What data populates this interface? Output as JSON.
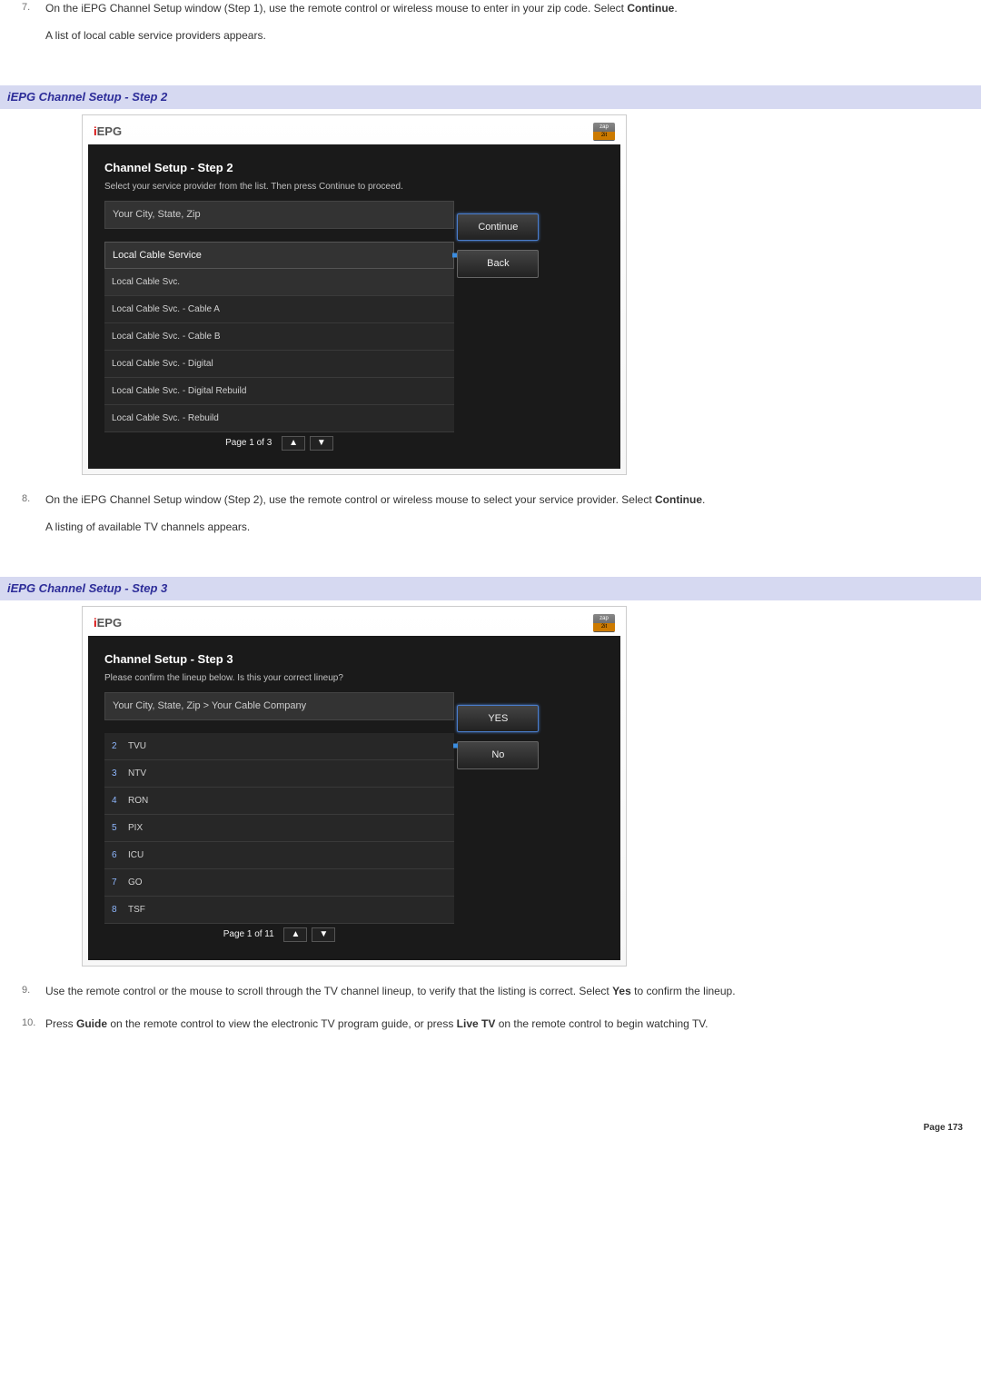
{
  "steps": {
    "s7": {
      "num": "7.",
      "text_a": "On the iEPG Channel Setup window (Step 1), use the remote control or wireless mouse to enter in your zip code. Select ",
      "text_b": "Continue",
      "text_c": ".",
      "note": "A list of local cable service providers appears."
    },
    "s8": {
      "num": "8.",
      "text_a": "On the iEPG Channel Setup window (Step 2), use the remote control or wireless mouse to select your service provider. Select ",
      "text_b": "Continue",
      "text_c": ".",
      "note": "A listing of available TV channels appears."
    },
    "s9": {
      "num": "9.",
      "text_a": "Use the remote control or the mouse to scroll through the TV channel lineup, to verify that the listing is correct. Select ",
      "text_b": "Yes",
      "text_c": " to confirm the lineup."
    },
    "s10": {
      "num": "10.",
      "text_a": "Press ",
      "text_b": "Guide",
      "text_c": " on the remote control to view the electronic TV program guide, or press ",
      "text_d": "Live TV",
      "text_e": " on the remote control to begin watching TV."
    }
  },
  "section2": {
    "title": "iEPG Channel Setup - Step 2"
  },
  "section3": {
    "title": "iEPG Channel Setup - Step 3"
  },
  "window2": {
    "logo_i": "i",
    "logo_rest": "EPG",
    "title": "Channel Setup - Step 2",
    "subtitle": "Select your service provider from the list. Then press Continue to proceed.",
    "breadcrumb": "Your City, State, Zip",
    "list_header": "Local Cable Service",
    "rows": [
      "Local Cable Svc.",
      "Local Cable Svc.   - Cable A",
      "Local Cable Svc.   - Cable B",
      "Local Cable Svc.   - Digital",
      "Local Cable Svc.   - Digital Rebuild",
      "Local Cable Svc.   - Rebuild"
    ],
    "btn_continue": "Continue",
    "btn_back": "Back",
    "pager_label": "Page 1 of 3",
    "pager_up": "▲",
    "pager_down": "▼"
  },
  "window3": {
    "logo_i": "i",
    "logo_rest": "EPG",
    "title": "Channel Setup - Step 3",
    "subtitle": "Please confirm the lineup below. Is this your correct lineup?",
    "breadcrumb": "Your City, State, Zip  >  Your Cable Company",
    "rows": [
      {
        "num": "2",
        "name": "TVU"
      },
      {
        "num": "3",
        "name": "NTV"
      },
      {
        "num": "4",
        "name": "RON"
      },
      {
        "num": "5",
        "name": "PIX"
      },
      {
        "num": "6",
        "name": "ICU"
      },
      {
        "num": "7",
        "name": "GO"
      },
      {
        "num": "8",
        "name": "TSF"
      }
    ],
    "btn_yes": "YES",
    "btn_no": "No",
    "pager_label": "Page 1 of 11",
    "pager_up": "▲",
    "pager_down": "▼"
  },
  "footer": {
    "page": "Page 173"
  }
}
